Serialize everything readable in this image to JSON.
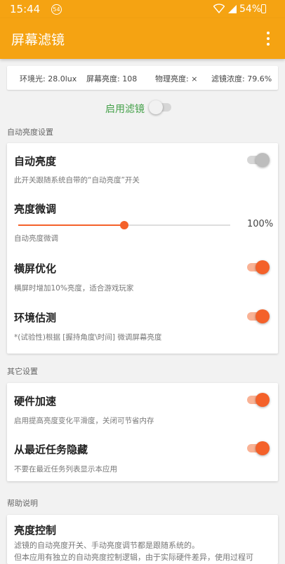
{
  "status": {
    "time": "15:44",
    "badge": "54",
    "battery": "54%"
  },
  "appbar": {
    "title": "屏幕滤镜"
  },
  "stats": {
    "ambient": "环境光: 28.0lux",
    "screen": "屏幕亮度: 108",
    "physical": "物理亮度: ×",
    "filter": "滤镜浓度: 79.6%"
  },
  "master": {
    "label": "启用滤镜",
    "enabled": false
  },
  "auto_section": {
    "title": "自动亮度设置",
    "auto_brightness": {
      "title": "自动亮度",
      "desc": "此开关跟随系统自带的“自动亮度”开关",
      "enabled": false
    },
    "fine_tune": {
      "title": "亮度微调",
      "desc": "自动亮度微调",
      "value": "100%",
      "level": 0.5
    },
    "landscape": {
      "title": "横屏优化",
      "desc": "横屏时增加10%亮度，适合游戏玩家",
      "enabled": true
    },
    "estimate": {
      "title": "环境估测",
      "desc": "*(试验性)根据 [握持角度\\时间] 微调屏幕亮度",
      "enabled": true
    }
  },
  "other_section": {
    "title": "其它设置",
    "hw_accel": {
      "title": "硬件加速",
      "desc": "启用提高亮度变化平滑度，关闭可节省内存",
      "enabled": true
    },
    "hide_recent": {
      "title": "从最近任务隐藏",
      "desc": "不要在最近任务列表显示本应用",
      "enabled": true
    }
  },
  "help_section": {
    "title": "帮助说明",
    "brightness_control": {
      "title": "亮度控制",
      "line1": "滤镜的自动亮度开关、手动亮度调节都是跟随系统的。",
      "line2": "但本应用有独立的自动亮度控制逻辑，由于实际硬件差异，使用过程可"
    }
  },
  "colors": {
    "primary": "#f5a312",
    "accent": "#f4612a",
    "enabled_label": "#45a14a"
  }
}
